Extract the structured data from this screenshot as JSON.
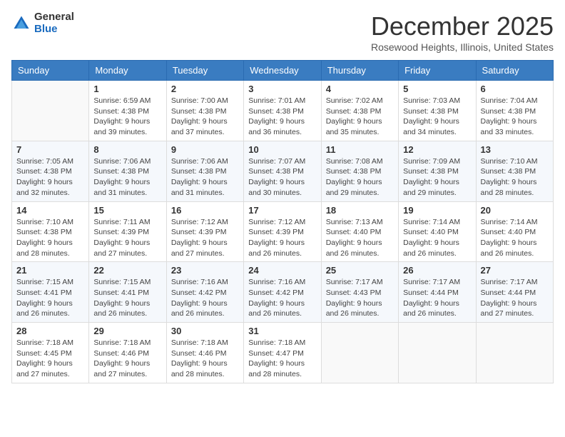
{
  "header": {
    "logo": {
      "general": "General",
      "blue": "Blue"
    },
    "title": "December 2025",
    "location": "Rosewood Heights, Illinois, United States"
  },
  "calendar": {
    "days_of_week": [
      "Sunday",
      "Monday",
      "Tuesday",
      "Wednesday",
      "Thursday",
      "Friday",
      "Saturday"
    ],
    "weeks": [
      [
        {
          "day": "",
          "info": ""
        },
        {
          "day": "1",
          "info": "Sunrise: 6:59 AM\nSunset: 4:38 PM\nDaylight: 9 hours\nand 39 minutes."
        },
        {
          "day": "2",
          "info": "Sunrise: 7:00 AM\nSunset: 4:38 PM\nDaylight: 9 hours\nand 37 minutes."
        },
        {
          "day": "3",
          "info": "Sunrise: 7:01 AM\nSunset: 4:38 PM\nDaylight: 9 hours\nand 36 minutes."
        },
        {
          "day": "4",
          "info": "Sunrise: 7:02 AM\nSunset: 4:38 PM\nDaylight: 9 hours\nand 35 minutes."
        },
        {
          "day": "5",
          "info": "Sunrise: 7:03 AM\nSunset: 4:38 PM\nDaylight: 9 hours\nand 34 minutes."
        },
        {
          "day": "6",
          "info": "Sunrise: 7:04 AM\nSunset: 4:38 PM\nDaylight: 9 hours\nand 33 minutes."
        }
      ],
      [
        {
          "day": "7",
          "info": "Sunrise: 7:05 AM\nSunset: 4:38 PM\nDaylight: 9 hours\nand 32 minutes."
        },
        {
          "day": "8",
          "info": "Sunrise: 7:06 AM\nSunset: 4:38 PM\nDaylight: 9 hours\nand 31 minutes."
        },
        {
          "day": "9",
          "info": "Sunrise: 7:06 AM\nSunset: 4:38 PM\nDaylight: 9 hours\nand 31 minutes."
        },
        {
          "day": "10",
          "info": "Sunrise: 7:07 AM\nSunset: 4:38 PM\nDaylight: 9 hours\nand 30 minutes."
        },
        {
          "day": "11",
          "info": "Sunrise: 7:08 AM\nSunset: 4:38 PM\nDaylight: 9 hours\nand 29 minutes."
        },
        {
          "day": "12",
          "info": "Sunrise: 7:09 AM\nSunset: 4:38 PM\nDaylight: 9 hours\nand 29 minutes."
        },
        {
          "day": "13",
          "info": "Sunrise: 7:10 AM\nSunset: 4:38 PM\nDaylight: 9 hours\nand 28 minutes."
        }
      ],
      [
        {
          "day": "14",
          "info": "Sunrise: 7:10 AM\nSunset: 4:38 PM\nDaylight: 9 hours\nand 28 minutes."
        },
        {
          "day": "15",
          "info": "Sunrise: 7:11 AM\nSunset: 4:39 PM\nDaylight: 9 hours\nand 27 minutes."
        },
        {
          "day": "16",
          "info": "Sunrise: 7:12 AM\nSunset: 4:39 PM\nDaylight: 9 hours\nand 27 minutes."
        },
        {
          "day": "17",
          "info": "Sunrise: 7:12 AM\nSunset: 4:39 PM\nDaylight: 9 hours\nand 26 minutes."
        },
        {
          "day": "18",
          "info": "Sunrise: 7:13 AM\nSunset: 4:40 PM\nDaylight: 9 hours\nand 26 minutes."
        },
        {
          "day": "19",
          "info": "Sunrise: 7:14 AM\nSunset: 4:40 PM\nDaylight: 9 hours\nand 26 minutes."
        },
        {
          "day": "20",
          "info": "Sunrise: 7:14 AM\nSunset: 4:40 PM\nDaylight: 9 hours\nand 26 minutes."
        }
      ],
      [
        {
          "day": "21",
          "info": "Sunrise: 7:15 AM\nSunset: 4:41 PM\nDaylight: 9 hours\nand 26 minutes."
        },
        {
          "day": "22",
          "info": "Sunrise: 7:15 AM\nSunset: 4:41 PM\nDaylight: 9 hours\nand 26 minutes."
        },
        {
          "day": "23",
          "info": "Sunrise: 7:16 AM\nSunset: 4:42 PM\nDaylight: 9 hours\nand 26 minutes."
        },
        {
          "day": "24",
          "info": "Sunrise: 7:16 AM\nSunset: 4:42 PM\nDaylight: 9 hours\nand 26 minutes."
        },
        {
          "day": "25",
          "info": "Sunrise: 7:17 AM\nSunset: 4:43 PM\nDaylight: 9 hours\nand 26 minutes."
        },
        {
          "day": "26",
          "info": "Sunrise: 7:17 AM\nSunset: 4:44 PM\nDaylight: 9 hours\nand 26 minutes."
        },
        {
          "day": "27",
          "info": "Sunrise: 7:17 AM\nSunset: 4:44 PM\nDaylight: 9 hours\nand 27 minutes."
        }
      ],
      [
        {
          "day": "28",
          "info": "Sunrise: 7:18 AM\nSunset: 4:45 PM\nDaylight: 9 hours\nand 27 minutes."
        },
        {
          "day": "29",
          "info": "Sunrise: 7:18 AM\nSunset: 4:46 PM\nDaylight: 9 hours\nand 27 minutes."
        },
        {
          "day": "30",
          "info": "Sunrise: 7:18 AM\nSunset: 4:46 PM\nDaylight: 9 hours\nand 28 minutes."
        },
        {
          "day": "31",
          "info": "Sunrise: 7:18 AM\nSunset: 4:47 PM\nDaylight: 9 hours\nand 28 minutes."
        },
        {
          "day": "",
          "info": ""
        },
        {
          "day": "",
          "info": ""
        },
        {
          "day": "",
          "info": ""
        }
      ]
    ]
  }
}
